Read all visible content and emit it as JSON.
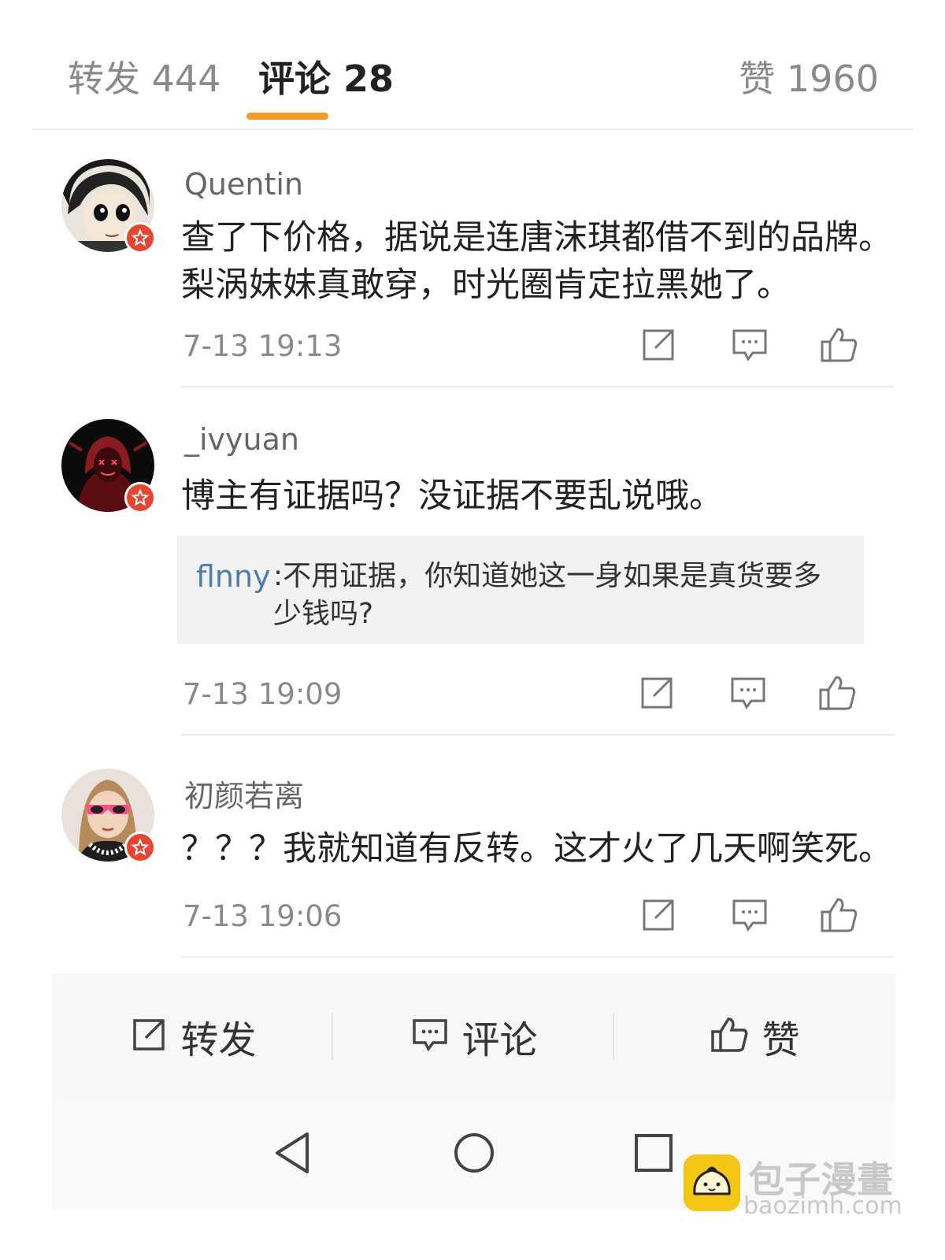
{
  "tabs": {
    "repost": "转发 444",
    "comments": "评论 28",
    "likes": "赞 1960"
  },
  "comments": [
    {
      "username": "Quentin",
      "text": "查了下价格，据说是连唐沫琪都借不到的品牌。梨涡妹妹真敢穿，时光圈肯定拉黑她了。",
      "time": "7-13  19:13"
    },
    {
      "username": "_ivyuan",
      "text": "博主有证据吗？没证据不要乱说哦。",
      "reply": {
        "user": "flnny",
        "text": ":不用证据，你知道她这一身如果是真货要多少钱吗?"
      },
      "time": "7-13  19:09"
    },
    {
      "username": "初颜若离",
      "text": "？？？我就知道有反转。这才火了几天啊笑死。",
      "time": "7-13  19:06"
    }
  ],
  "bottom_bar": {
    "repost": "转发",
    "comment": "评论",
    "like": "赞"
  },
  "watermark": {
    "title": "包子漫畫",
    "url": "baozimh.com"
  },
  "colors": {
    "accent": "#f79a1e",
    "badge": "#e8442f",
    "reply_user": "#4a7cb0"
  },
  "icons": {
    "share": "share-icon",
    "comment": "comment-icon",
    "like": "thumbs-up-icon",
    "back": "back-triangle-icon",
    "home": "home-circle-icon",
    "recents": "recents-square-icon"
  }
}
